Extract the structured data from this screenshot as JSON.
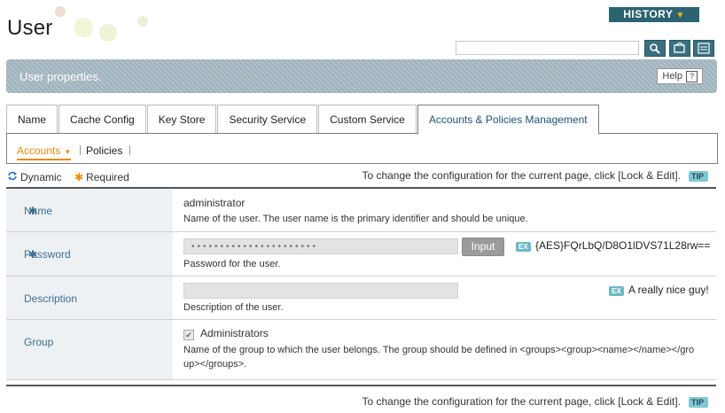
{
  "page": {
    "title": "User"
  },
  "history": {
    "label": "HISTORY",
    "arrow": "▼"
  },
  "search": {
    "placeholder": ""
  },
  "toolbar": {
    "search_icon": "magnifier-icon",
    "refresh_icon": "refresh-icon",
    "xml_icon": "xml-icon"
  },
  "props": {
    "title": "User properties.",
    "help_label": "Help",
    "help_icon": "?"
  },
  "tabs": [
    {
      "label": "Name"
    },
    {
      "label": "Cache Config"
    },
    {
      "label": "Key Store"
    },
    {
      "label": "Security Service"
    },
    {
      "label": "Custom Service"
    },
    {
      "label": "Accounts & Policies Management"
    }
  ],
  "subtabs": [
    {
      "label": "Accounts",
      "caret": "▼"
    },
    {
      "label": "Policies"
    }
  ],
  "legend": {
    "dynamic": "Dynamic",
    "required": "Required"
  },
  "tip": {
    "text": "To change the configuration for the current page, click [Lock & Edit].",
    "badge": "TIP"
  },
  "fields": {
    "name": {
      "label": "Name",
      "value": "administrator",
      "description": "Name of the user. The user name is the primary identifier and should be unique."
    },
    "password": {
      "label": "Password",
      "masked": "••••••••••••••••••••••",
      "button": "Input",
      "example_badge": "EX",
      "example": "{AES}FQrLbQ/D8O1lDVS71L28rw==",
      "description": "Password for the user."
    },
    "description": {
      "label": "Description",
      "value": "",
      "example_badge": "EX",
      "example": "A really nice guy!",
      "description": "Description of the user."
    },
    "group": {
      "label": "Group",
      "option": "Administrators",
      "checked": true,
      "description_line1": "Name of the group to which the user belongs. The group should be defined in <groups><group><name></name></gro",
      "description_line2": "up></groups>."
    }
  },
  "required_mark": "✱",
  "colors": {
    "accent": "#e8890b",
    "label_blue": "#3f6e91",
    "history_bg": "#2c6371"
  }
}
